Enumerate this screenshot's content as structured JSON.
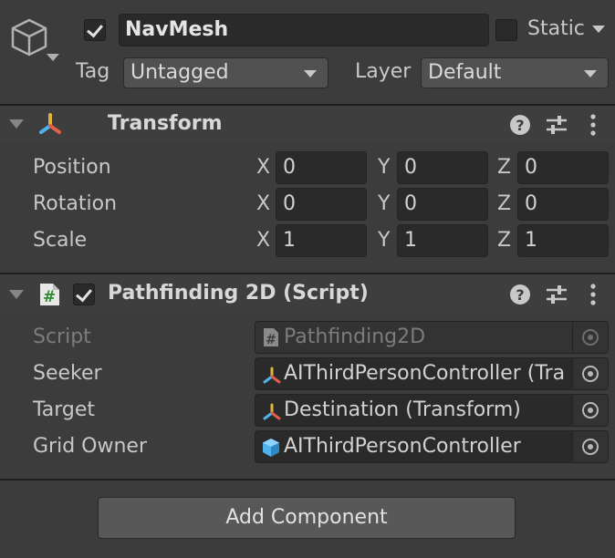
{
  "gameobject": {
    "name": "NavMesh",
    "active_checked": true,
    "static_label": "Static",
    "static_checked": false,
    "tag_label": "Tag",
    "tag_value": "Untagged",
    "layer_label": "Layer",
    "layer_value": "Default"
  },
  "transform": {
    "title": "Transform",
    "rows": [
      {
        "label": "Position",
        "x": "0",
        "y": "0",
        "z": "0"
      },
      {
        "label": "Rotation",
        "x": "0",
        "y": "0",
        "z": "0"
      },
      {
        "label": "Scale",
        "x": "1",
        "y": "1",
        "z": "1"
      }
    ],
    "axis_x": "X",
    "axis_y": "Y",
    "axis_z": "Z"
  },
  "script_component": {
    "title": "Pathfinding 2D (Script)",
    "enabled_checked": true,
    "fields": [
      {
        "label": "Script",
        "value": "Pathfinding2D",
        "icon": "script-hash-icon"
      },
      {
        "label": "Seeker",
        "value": "AIThirdPersonController (Tra",
        "icon": "transform-icon"
      },
      {
        "label": "Target",
        "value": "Destination (Transform)",
        "icon": "transform-icon"
      },
      {
        "label": "Grid Owner",
        "value": "AIThirdPersonController",
        "icon": "prefab-cube-icon"
      }
    ]
  },
  "add_component_label": "Add Component",
  "colors": {
    "background": "#3c3c3c",
    "field": "#2a2a2a",
    "prefab_blue": "#4fb3f0",
    "script_green": "#2f8a2f"
  }
}
